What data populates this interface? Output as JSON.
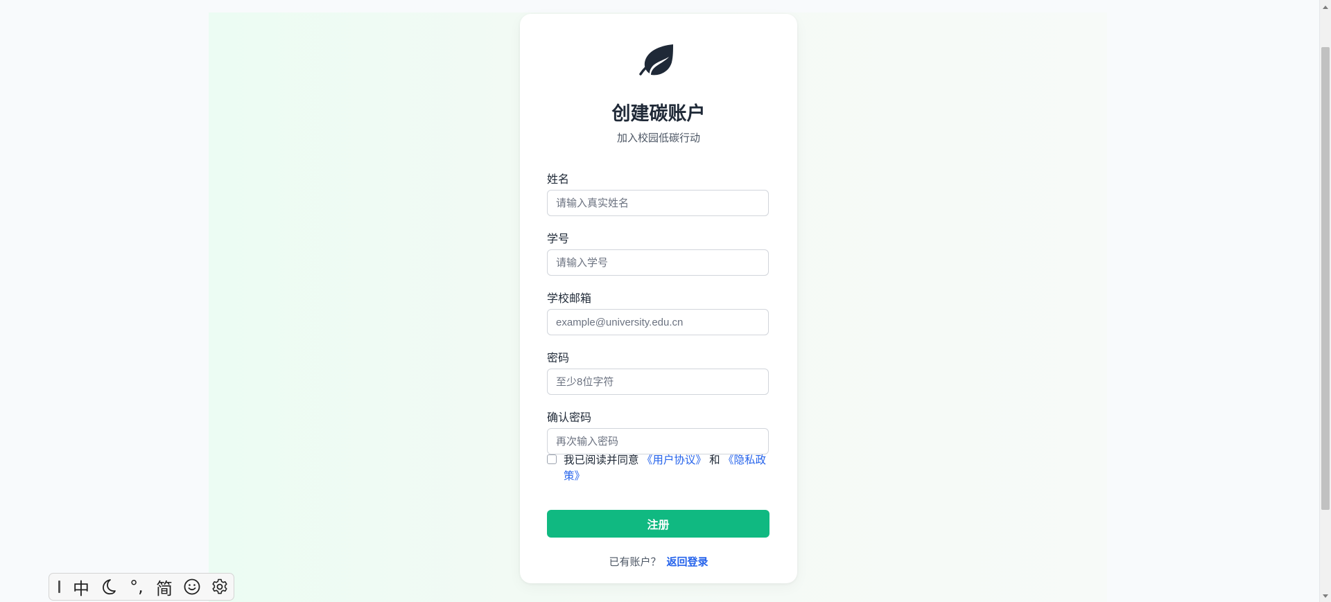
{
  "header": {
    "title": "创建碳账户",
    "subtitle": "加入校园低碳行动"
  },
  "form": {
    "name": {
      "label": "姓名",
      "placeholder": "请输入真实姓名"
    },
    "student_id": {
      "label": "学号",
      "placeholder": "请输入学号"
    },
    "email": {
      "label": "学校邮箱",
      "placeholder": "example@university.edu.cn"
    },
    "password": {
      "label": "密码",
      "placeholder": "至少8位字符"
    },
    "confirm_password": {
      "label": "确认密码",
      "placeholder": "再次输入密码"
    },
    "agreement": {
      "prefix": "我已阅读并同意",
      "terms_link": "《用户协议》",
      "conjunction": "和",
      "privacy_link": "《隐私政策》",
      "checked": false
    },
    "submit_label": "注册",
    "login_prompt": "已有账户？",
    "login_link": "返回登录"
  },
  "ime_toolbar": {
    "lang": "中",
    "punct": "°,",
    "charset": "简"
  },
  "colors": {
    "accent": "#10b981",
    "link": "#2563eb",
    "logo": "#1f2937"
  },
  "icons": [
    "leaf-icon",
    "moon-icon",
    "smiley-icon",
    "gear-icon"
  ]
}
